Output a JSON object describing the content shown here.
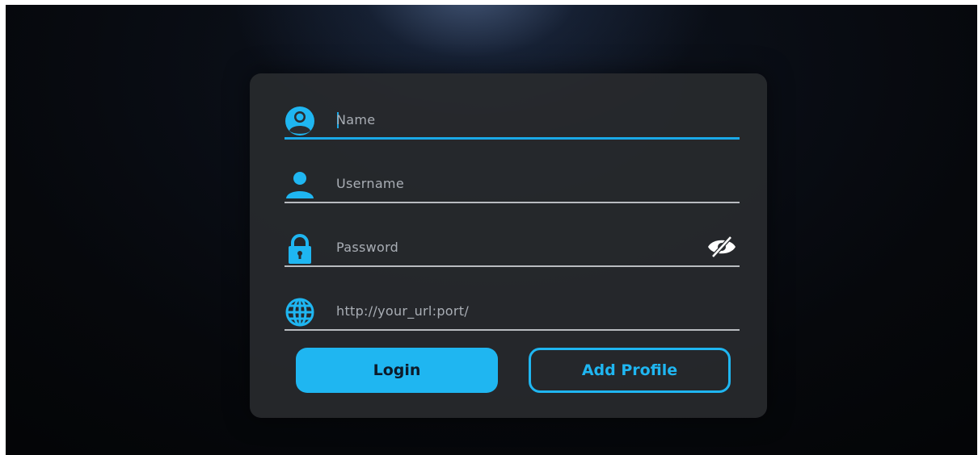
{
  "form": {
    "name": {
      "placeholder": "Name",
      "icon": "account-circle-icon"
    },
    "username": {
      "placeholder": "Username",
      "icon": "person-icon"
    },
    "password": {
      "placeholder": "Password",
      "icon": "lock-icon",
      "toggle_icon": "eye-off-icon"
    },
    "url": {
      "placeholder": "http://your_url:port/",
      "icon": "globe-icon"
    }
  },
  "buttons": {
    "login_label": "Login",
    "add_profile_label": "Add Profile"
  },
  "colors": {
    "accent": "#1fb6f1",
    "card": "#2a2c30",
    "text_muted": "#a9aeb5"
  }
}
